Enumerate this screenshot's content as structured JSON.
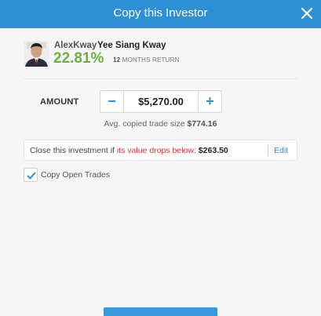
{
  "header": {
    "title": "Copy this Investor",
    "close_icon": "close-icon"
  },
  "investor": {
    "username": "AlexKway",
    "full_name": "Yee Siang Kway",
    "return_value": "22.81%",
    "return_months": "12",
    "return_period_label": "MONTHS RETURN",
    "avatar_icon": "avatar-photo"
  },
  "amount": {
    "label": "AMOUNT",
    "value": "$5,270.00",
    "minus_label": "−",
    "plus_label": "+"
  },
  "avg_trade": {
    "label": "Avg. copied trade size",
    "value": "$774.16"
  },
  "stop_loss": {
    "prefix": "Close this investment if ",
    "condition": "its value drops below:",
    "value": "$263.50",
    "edit_label": "Edit"
  },
  "copy_open_trades": {
    "label": "Copy Open Trades",
    "checked": true
  },
  "colors": {
    "header_bg": "#2d8fd5",
    "positive": "#6cb33e",
    "warning": "#d6373a",
    "accent": "#2d8fd5"
  }
}
